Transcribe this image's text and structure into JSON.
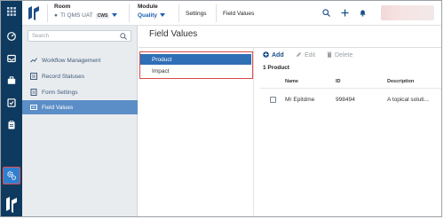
{
  "topbar": {
    "room_label": "Room",
    "room_value": "TI QMS UAT",
    "room_badge": "CWS",
    "module_label": "Module",
    "module_value": "Quality",
    "crumb_settings": "Settings",
    "crumb_page": "Field Values"
  },
  "sidebar": {
    "search_placeholder": "Search",
    "items": [
      {
        "label": "Workflow Management",
        "icon": "workflow-icon"
      },
      {
        "label": "Record Statuses",
        "icon": "statuses-icon"
      },
      {
        "label": "Form Settings",
        "icon": "form-icon"
      },
      {
        "label": "Field Values",
        "icon": "field-values-icon",
        "active": true
      }
    ]
  },
  "main": {
    "title": "Field Values",
    "fields": [
      {
        "label": "Product",
        "selected": true
      },
      {
        "label": "Impact",
        "selected": false
      }
    ],
    "toolbar": {
      "add": "Add",
      "edit": "Edit",
      "delete": "Delete"
    },
    "count": "1 Product",
    "columns": [
      "Name",
      "ID",
      "Description"
    ],
    "rows": [
      {
        "name": "Mr Epitdme",
        "id": "998494",
        "description": "A topical soluti..."
      }
    ]
  },
  "colors": {
    "rail": "#0f3a5f",
    "accent": "#2f6fb5",
    "highlight_border": "#d94848",
    "sidebar_active": "#5b8ec6"
  }
}
